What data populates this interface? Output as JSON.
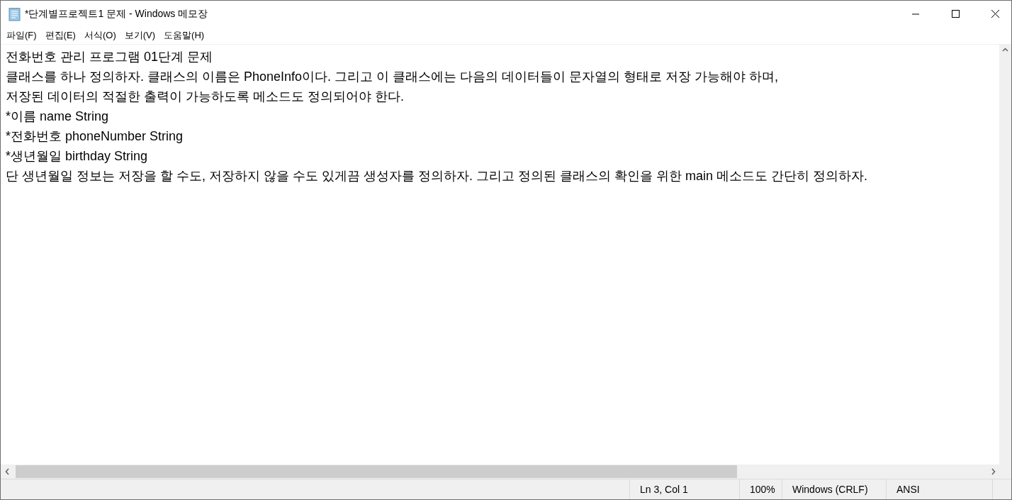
{
  "window": {
    "title": "*단계별프로젝트1 문제 - Windows 메모장"
  },
  "menu": [
    "파일(F)",
    "편집(E)",
    "서식(O)",
    "보기(V)",
    "도움말(H)"
  ],
  "document": {
    "lines": [
      "전화번호 관리 프로그램 01단계 문제",
      "클래스를 하나 정의하자. 클래스의 이름은 PhoneInfo이다. 그리고 이 클래스에는 다음의 데이터들이 문자열의 형태로 저장 가능해야 하며,",
      "저장된 데이터의 적절한 출력이 가능하도록 메소드도 정의되어야 한다.",
      "*이름 name String",
      "*전화번호 phoneNumber String",
      "*생년월일 birthday String",
      "단 생년월일 정보는 저장을 할 수도, 저장하지 않을 수도 있게끔 생성자를 정의하자. 그리고 정의된 클래스의 확인을 위한 main 메소드도 간단히 정의하자."
    ]
  },
  "status_bar": [
    "Ln 3, Col 1",
    "100%",
    "Windows (CRLF)",
    "ANSI"
  ]
}
